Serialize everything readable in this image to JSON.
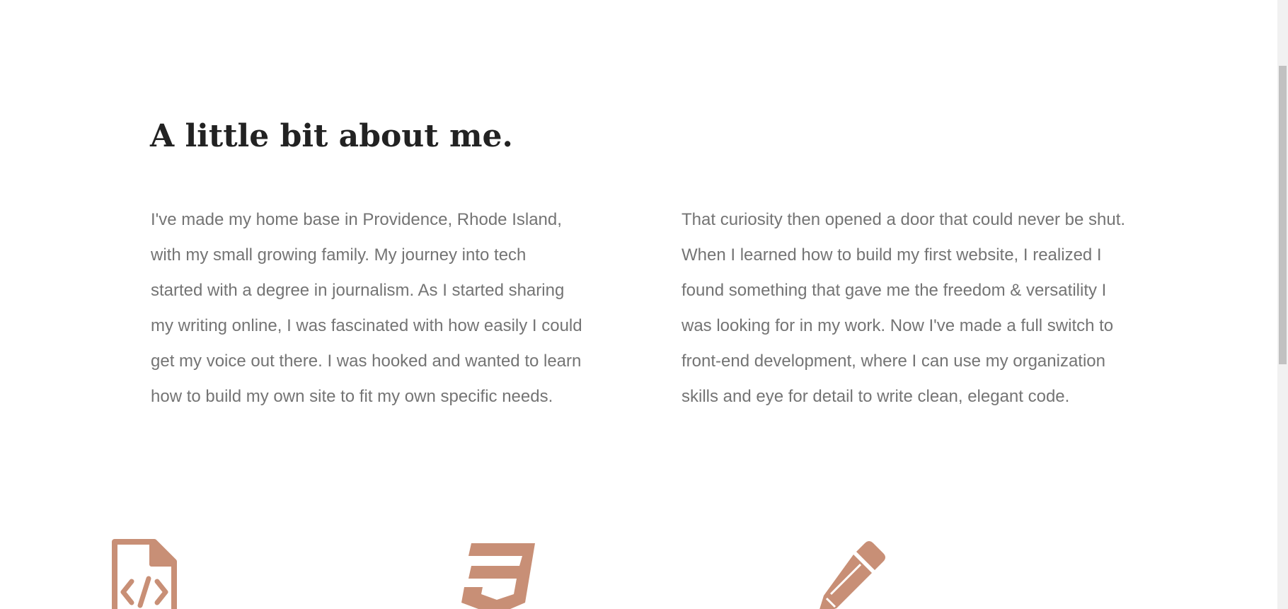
{
  "about": {
    "heading": "A little bit about me.",
    "paragraph_left": "I've made my home base in Providence, Rhode Island, with my small growing family. My journey into tech started with a degree in journalism. As I started sharing my writing online, I was fascinated with how easily I could get my voice out there. I was hooked and wanted to learn how to build my own site to fit my own specific needs.",
    "paragraph_right": "That curiosity then opened a door that could never be shut. When I learned how to build my first website, I realized I found something that gave me the freedom & versatility I was looking for in my work. Now I've made a full switch to front-end development, where I can use my organization skills and eye for detail to write clean, elegant code."
  },
  "features": [
    {
      "icon": "code-file-icon"
    },
    {
      "icon": "css3-icon"
    },
    {
      "icon": "pencil-icon"
    }
  ],
  "colors": {
    "accent": "#c88f76",
    "heading": "#222222",
    "body_text": "#747474",
    "background": "#ffffff",
    "scrollbar_track": "#f1f1f1",
    "scrollbar_thumb": "#c1c1c1"
  }
}
